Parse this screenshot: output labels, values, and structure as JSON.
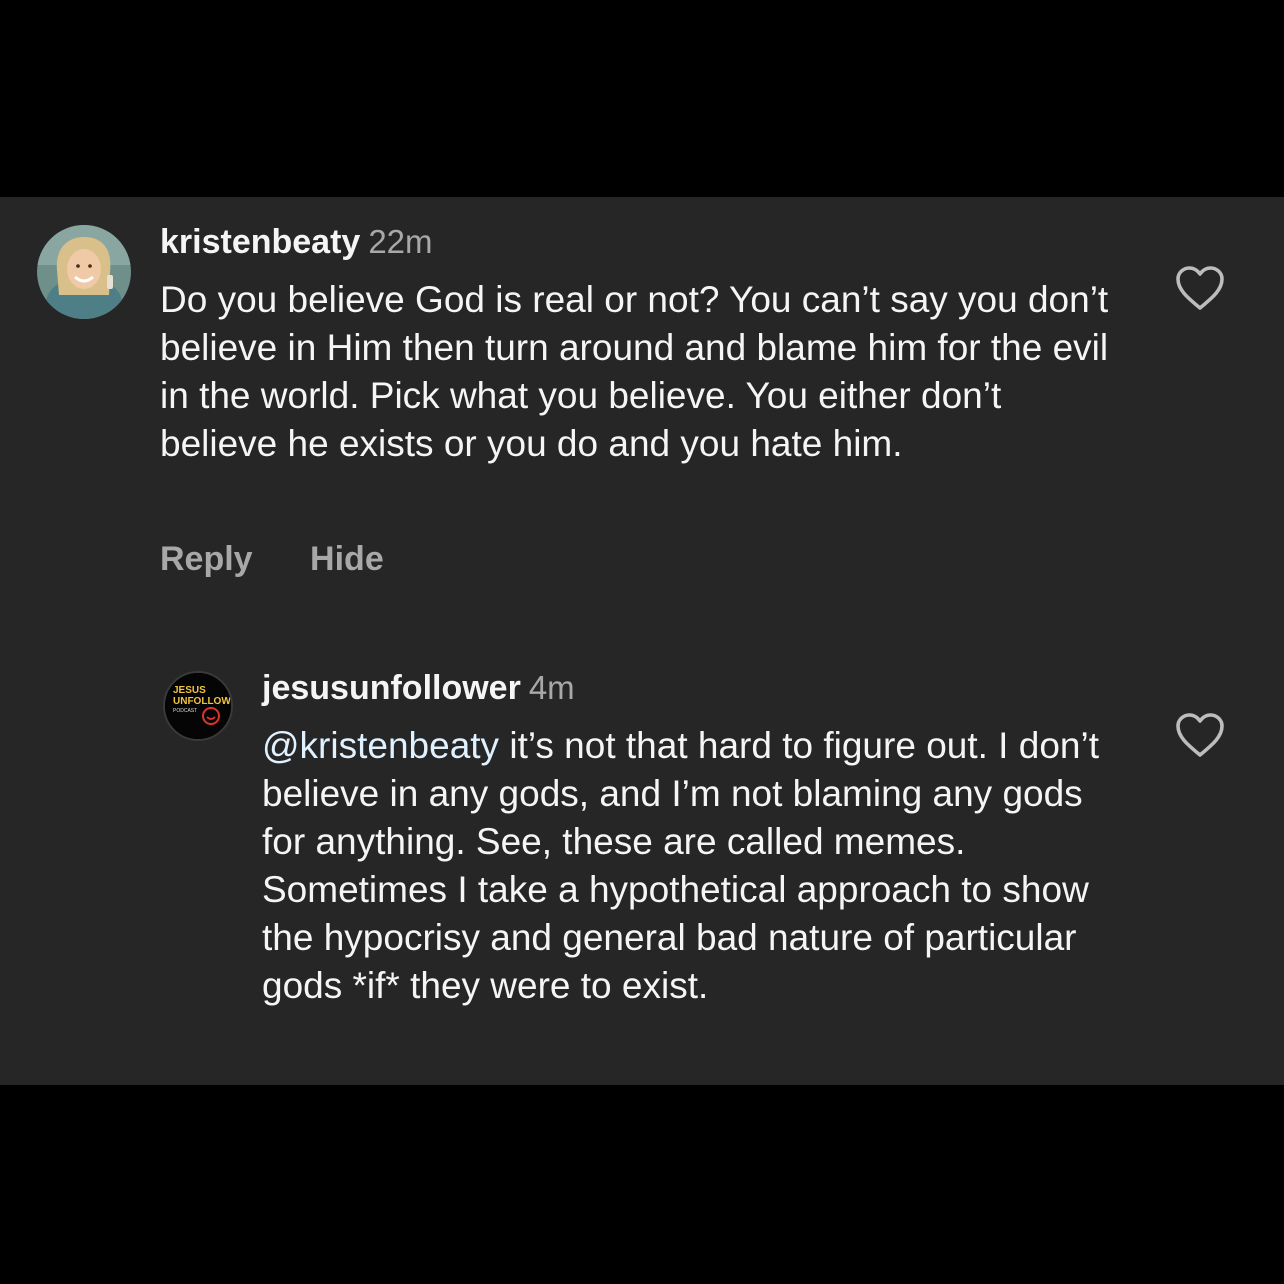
{
  "comments": [
    {
      "username": "kristenbeaty",
      "time": "22m",
      "text": "Do you believe God is real or not? You can’t say you don’t believe in Him then turn around and blame him for the evil in the world. Pick what you believe. You either don’t believe he exists or you do and you hate him.",
      "actions": {
        "reply": "Reply",
        "hide": "Hide"
      },
      "like_icon": "heart-outline-icon"
    },
    {
      "username": "jesusunfollower",
      "time": "4m",
      "mention": "@kristenbeaty",
      "text": " it’s not that hard to figure out. I don’t believe in any gods, and I’m not blaming any gods for anything. See, these are called memes. Sometimes I take a hypothetical approach to show the hypocrisy and general bad nature of particular gods *if* they were to exist.",
      "avatar_logo": {
        "line1": "JESUS",
        "line2": "UNFOLLOWER",
        "line3": "PODCAST"
      },
      "like_icon": "heart-outline-icon"
    }
  ],
  "colors": {
    "background": "#000000",
    "panel": "#262626",
    "primary_text": "#f5f5f5",
    "secondary_text": "#a8a8a8",
    "mention": "#e0f1ff"
  }
}
